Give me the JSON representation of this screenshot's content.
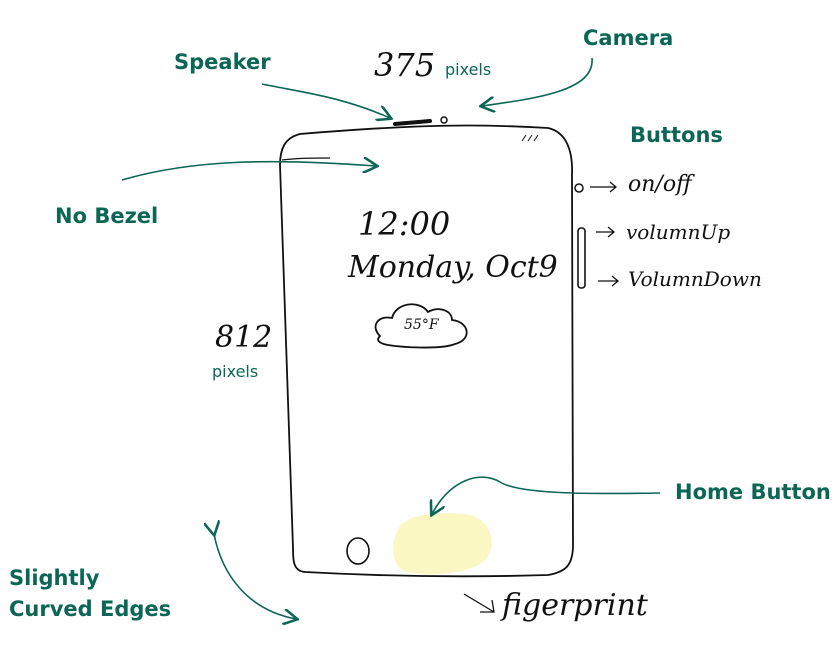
{
  "width_label": {
    "value": "375",
    "unit": "pixels"
  },
  "height_label": {
    "value": "812",
    "unit": "pixels"
  },
  "annotations": {
    "speaker": "Speaker",
    "camera": "Camera",
    "buttons": "Buttons",
    "no_bezel": "No Bezel",
    "home_button": "Home Button",
    "curved_edges_line1": "Slightly",
    "curved_edges_line2": "Curved Edges"
  },
  "side_buttons": [
    {
      "label": "on/off"
    },
    {
      "label": "volumnUp"
    },
    {
      "label": "VolumnDown"
    }
  ],
  "lock_screen": {
    "time": "12:00",
    "date": "Monday, Oct9",
    "weather": "55°F"
  },
  "fingerprint_note": "figerprint",
  "colors": {
    "annotation": "#0b6655",
    "sketch_stroke": "#111111",
    "fingerprint_highlight": "#fbf7c2"
  },
  "icons": {
    "cloud": "cloud-icon",
    "home": "home-button-circle"
  }
}
